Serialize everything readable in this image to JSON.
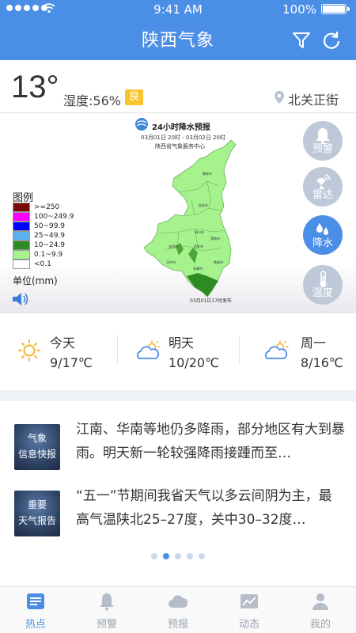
{
  "status_bar": {
    "time": "9:41 AM",
    "battery": "100%"
  },
  "header": {
    "title": "陕西气象",
    "filter_icon": "filter-icon",
    "refresh_icon": "refresh-icon"
  },
  "current": {
    "temperature": "13°",
    "humidity": "湿度:56%",
    "air_quality": "良",
    "location": "北关正街"
  },
  "map": {
    "title": "24小时降水预报",
    "date_range": "03月01日 20时 - 03月02日 20时",
    "organization": "陕西省气象服务中心",
    "published": "03月01日17时发布",
    "legend_title": "图例",
    "unit": "单位(mm)",
    "legend": [
      {
        "label": ">=250",
        "color": "#7a0a0a"
      },
      {
        "label": "100~249.9",
        "color": "#ff00ff"
      },
      {
        "label": "50~99.9",
        "color": "#0000ff"
      },
      {
        "label": "25~49.9",
        "color": "#5ab0f0"
      },
      {
        "label": "10~24.9",
        "color": "#2e8b22"
      },
      {
        "label": "0.1~9.9",
        "color": "#a6f28d"
      },
      {
        "label": "<0.1",
        "color": "#ffffff"
      }
    ],
    "side_buttons": [
      {
        "label": "预警",
        "icon": "bell-icon"
      },
      {
        "label": "雷达",
        "icon": "radar-icon"
      },
      {
        "label": "降水",
        "icon": "raindrop-icon"
      },
      {
        "label": "温度",
        "icon": "thermometer-icon"
      }
    ]
  },
  "forecast": [
    {
      "day": "今天",
      "temp": "9/17℃",
      "icon": "sun-icon"
    },
    {
      "day": "明天",
      "temp": "10/20℃",
      "icon": "partly-cloudy-icon"
    },
    {
      "day": "周一",
      "temp": "8/16℃",
      "icon": "partly-cloudy-icon"
    }
  ],
  "news": [
    {
      "thumb_line1": "气象",
      "thumb_line2": "信息快报",
      "text": "江南、华南等地仍多降雨，部分地区有大到暴雨。明天新一轮较强降雨接踵而至…"
    },
    {
      "thumb_line1": "重要",
      "thumb_line2": "天气报告",
      "text": "“五一”节期间我省天气以多云间阴为主，最高气温陕北25–27度，关中30–32度…"
    }
  ],
  "pager": {
    "count": 5,
    "active_index": 1
  },
  "bottom_nav": [
    {
      "label": "热点",
      "icon": "news-icon",
      "active": true
    },
    {
      "label": "预警",
      "icon": "bell-icon",
      "active": false
    },
    {
      "label": "预报",
      "icon": "cloud-icon",
      "active": false
    },
    {
      "label": "动态",
      "icon": "chart-icon",
      "active": false
    },
    {
      "label": "我的",
      "icon": "user-icon",
      "active": false
    }
  ],
  "colors": {
    "brand": "#4b8ee6",
    "aqi_good": "#f7c430",
    "inactive_nav": "#9aa4b2"
  }
}
